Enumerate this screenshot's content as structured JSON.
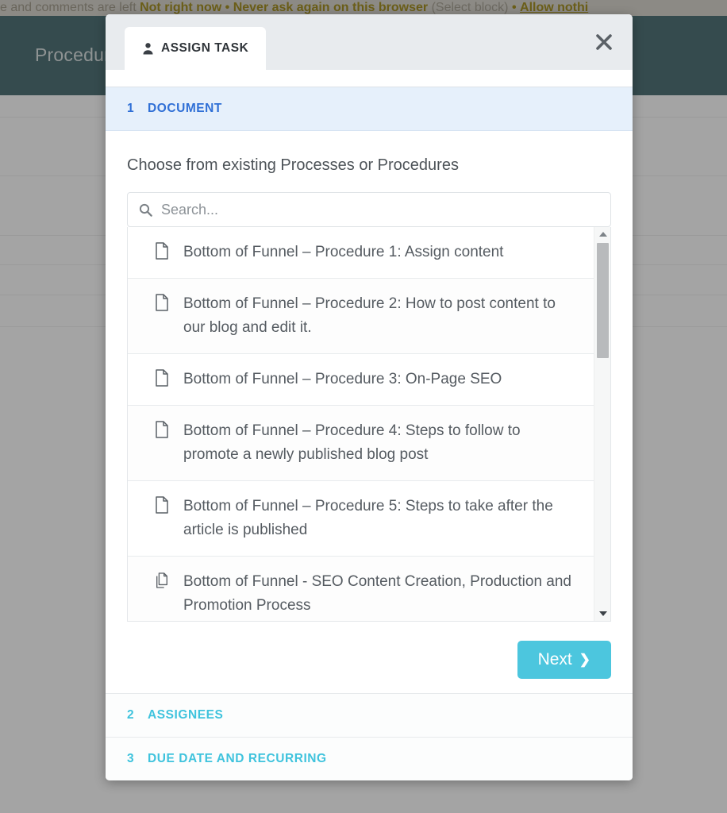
{
  "background": {
    "cookie_banner": {
      "lead_text": "e and comments are left",
      "action_primary": "Not right now",
      "separator": "•",
      "action_secondary": "Never ask again on this browser",
      "hint": "(Select block)",
      "separator2": "•",
      "action_link": "Allow nothi"
    },
    "header_title": "Procedure",
    "header_color": "#0b3a41",
    "overlay_color": "rgba(90,90,90,0.55)"
  },
  "modal": {
    "tab": {
      "label": "ASSIGN TASK",
      "icon": "person-icon"
    },
    "close_icon": "close-icon",
    "steps": [
      {
        "number": "1",
        "label": "DOCUMENT",
        "state": "active",
        "accent": "#2f6fd6"
      },
      {
        "number": "2",
        "label": "ASSIGNEES",
        "state": "inactive",
        "accent": "#3fc3dd"
      },
      {
        "number": "3",
        "label": "DUE DATE AND RECURRING",
        "state": "inactive",
        "accent": "#3fc3dd"
      }
    ],
    "document_step": {
      "instruction": "Choose from existing Processes or Procedures",
      "search": {
        "placeholder": "Search...",
        "value": "",
        "icon": "search-icon"
      },
      "items": [
        {
          "icon": "document-icon",
          "title": "Bottom of Funnel – Procedure 1: Assign content"
        },
        {
          "icon": "document-icon",
          "title": "Bottom of Funnel – Procedure 2: How to post content to our blog and edit it."
        },
        {
          "icon": "document-icon",
          "title": "Bottom of Funnel – Procedure 3: On-Page SEO"
        },
        {
          "icon": "document-icon",
          "title": "Bottom of Funnel – Procedure 4: Steps to follow to promote a newly published blog post"
        },
        {
          "icon": "document-icon",
          "title": "Bottom of Funnel – Procedure 5: Steps to take after the article is published"
        },
        {
          "icon": "documents-icon",
          "title": "Bottom of Funnel - SEO Content Creation, Production and Promotion Process"
        }
      ],
      "scrollbar": {
        "up_icon": "caret-up-icon",
        "down_icon": "caret-down-icon"
      },
      "next_button": {
        "label": "Next",
        "chevron": "❯",
        "color": "#4cc6de"
      }
    }
  }
}
